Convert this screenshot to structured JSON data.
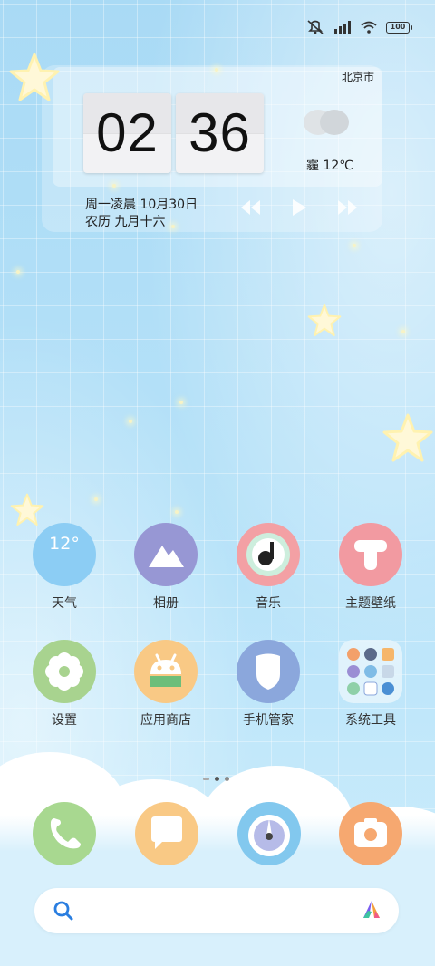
{
  "status_bar": {
    "icons": [
      "mute-icon",
      "signal-icon",
      "wifi-icon",
      "battery-icon"
    ],
    "battery": "100"
  },
  "clock_widget": {
    "city": "北京市",
    "hour": "02",
    "minute": "36",
    "weather": "霾 12℃",
    "date_line": "周一凌晨 10月30日",
    "lunar_line": "农历 九月十六"
  },
  "media_controls": [
    "previous-icon",
    "play-icon",
    "next-icon"
  ],
  "apps": [
    {
      "label": "天气",
      "icon_text": "12°",
      "color": "#8ccdf4"
    },
    {
      "label": "相册",
      "color": "#9797d4"
    },
    {
      "label": "音乐",
      "color": "#f3a0a4"
    },
    {
      "label": "主题壁纸",
      "color": "#f29aa1"
    },
    {
      "label": "设置",
      "color": "#a8d38f"
    },
    {
      "label": "应用商店",
      "color": "#f9c985"
    },
    {
      "label": "手机管家",
      "color": "#8ba7dc"
    },
    {
      "label": "系统工具",
      "color": "#d8ecfa"
    }
  ],
  "dock": [
    {
      "name": "phone",
      "color": "#a8d890"
    },
    {
      "name": "messages",
      "color": "#f9c985"
    },
    {
      "name": "browser",
      "color": "#82c8ee"
    },
    {
      "name": "camera",
      "color": "#f6a870"
    }
  ],
  "page_indicator": {
    "pages": 3,
    "active": 2
  },
  "search_bar": {
    "icon": "search-icon",
    "assistant": "assistant-icon"
  }
}
